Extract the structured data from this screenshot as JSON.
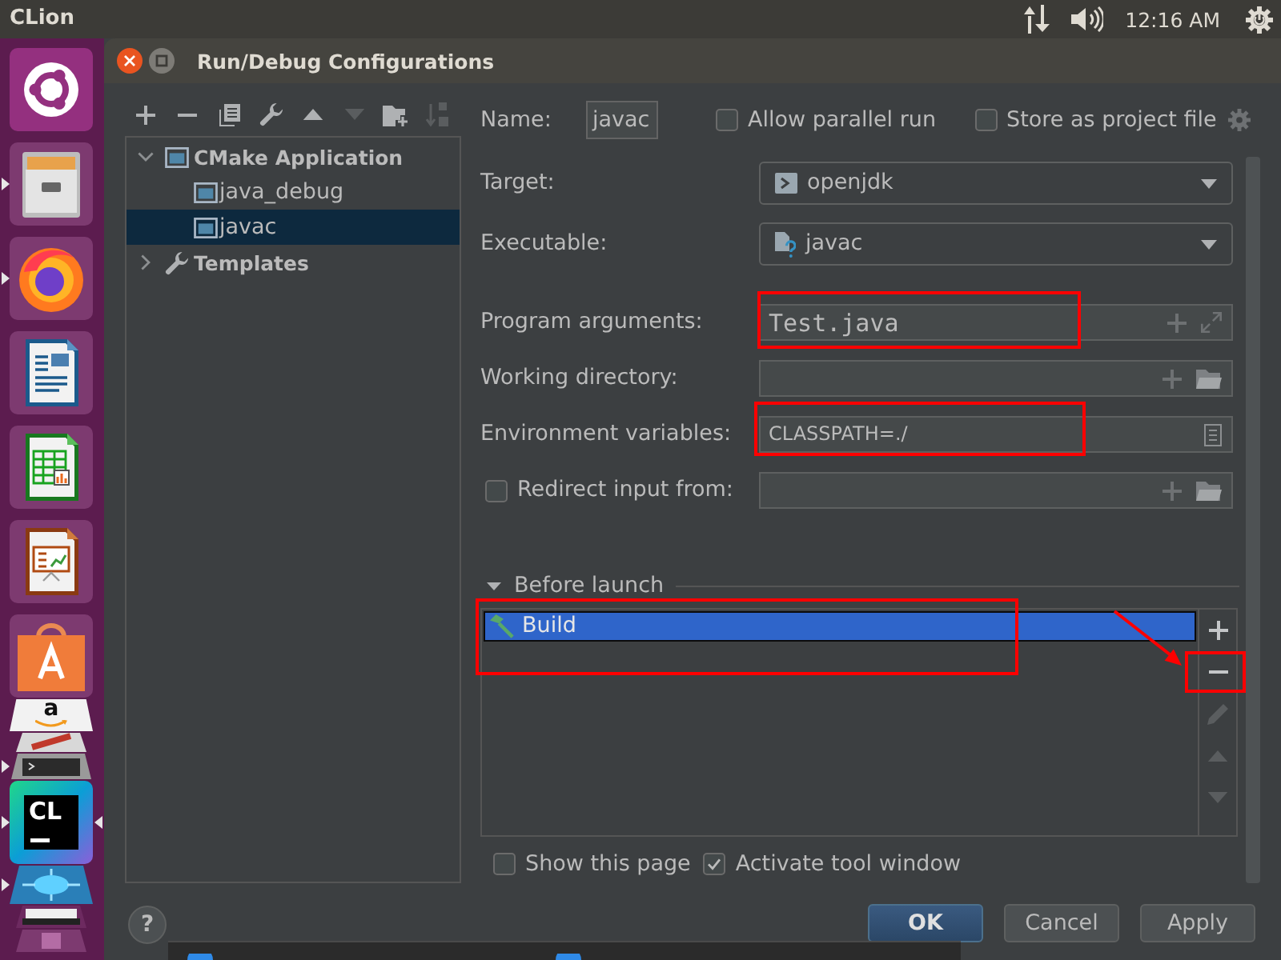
{
  "top_bar": {
    "title": "CLion",
    "clock": "12:16 AM"
  },
  "dock": [
    {
      "kind": "ubuntu",
      "running": false,
      "active": false,
      "folded": false
    },
    {
      "kind": "files",
      "running": true,
      "active": false,
      "folded": false
    },
    {
      "kind": "firefox",
      "running": true,
      "active": false,
      "folded": false
    },
    {
      "kind": "writer",
      "running": false,
      "active": false,
      "folded": false
    },
    {
      "kind": "calc",
      "running": false,
      "active": false,
      "folded": false
    },
    {
      "kind": "impress",
      "running": false,
      "active": false,
      "folded": false
    },
    {
      "kind": "software",
      "running": false,
      "active": false,
      "folded": false
    },
    {
      "kind": "amazon",
      "text": "a",
      "running": false,
      "active": false,
      "folded": true
    },
    {
      "kind": "editor",
      "running": false,
      "active": false,
      "folded": true
    },
    {
      "kind": "terminal",
      "running": true,
      "active": false,
      "folded": true
    },
    {
      "kind": "clion",
      "text": "CL",
      "running": true,
      "active": true,
      "folded": false
    },
    {
      "kind": "splash",
      "running": true,
      "active": false,
      "folded": true
    },
    {
      "kind": "printer",
      "running": false,
      "active": false,
      "folded": true
    },
    {
      "kind": "trash",
      "running": false,
      "active": false,
      "folded": true
    }
  ],
  "dialog": {
    "title": "Run/Debug Configurations",
    "toolbar": [
      {
        "kind": "add",
        "disabled": false
      },
      {
        "kind": "remove",
        "disabled": false
      },
      {
        "kind": "copy",
        "disabled": false
      },
      {
        "kind": "wrench",
        "disabled": false
      },
      {
        "kind": "move_up",
        "disabled": false
      },
      {
        "kind": "move_down",
        "disabled": true
      },
      {
        "kind": "folder",
        "disabled": false
      },
      {
        "kind": "sort",
        "disabled": true
      }
    ],
    "tree": [
      {
        "label": "CMake Application",
        "kind": "cmake",
        "expanded": true,
        "selected": false,
        "children": [
          {
            "label": "java_debug",
            "kind": "config",
            "selected": false
          },
          {
            "label": "javac",
            "kind": "config",
            "selected": true
          }
        ]
      },
      {
        "label": "Templates",
        "kind": "templates",
        "expanded": false,
        "selected": false
      }
    ],
    "name": {
      "label": "Name:",
      "value": "javac"
    },
    "options": [
      {
        "label": "Allow parallel run",
        "checked": false
      },
      {
        "label": "Store as project file",
        "checked": false
      }
    ],
    "fields": [
      {
        "label": "Target:",
        "kind": "target",
        "value": "openjdk",
        "annotated": false
      },
      {
        "label": "Executable:",
        "kind": "executable",
        "value": "javac",
        "annotated": false
      },
      {
        "label": "Program arguments:",
        "kind": "arguments",
        "value": "Test.java",
        "annotated": true
      },
      {
        "label": "Working directory:",
        "kind": "directory",
        "annotated": false
      },
      {
        "label": "Environment variables:",
        "kind": "environment",
        "value": "CLASSPATH=./",
        "annotated": true
      },
      {
        "label": "Redirect input from:",
        "kind": "redirect",
        "checked": false,
        "annotated": false
      }
    ],
    "before_launch": {
      "title": "Before launch",
      "expanded": true,
      "tasks": [
        {
          "label": "Build",
          "selected": true,
          "annotated": true
        }
      ],
      "tools": [
        {
          "kind": "add",
          "disabled": false,
          "annotated": false
        },
        {
          "kind": "remove",
          "disabled": false,
          "annotated": true
        },
        {
          "kind": "edit",
          "disabled": true,
          "annotated": false
        },
        {
          "kind": "move_up",
          "disabled": true,
          "annotated": false
        },
        {
          "kind": "move_down",
          "disabled": true,
          "annotated": false
        }
      ]
    },
    "launch_options": [
      {
        "label": "Show this page",
        "checked": false
      },
      {
        "label": "Activate tool window",
        "checked": true
      }
    ],
    "help": "?",
    "buttons": [
      {
        "label": "OK",
        "default": true
      },
      {
        "label": "Cancel",
        "default": false
      },
      {
        "label": "Apply",
        "default": false
      }
    ]
  }
}
